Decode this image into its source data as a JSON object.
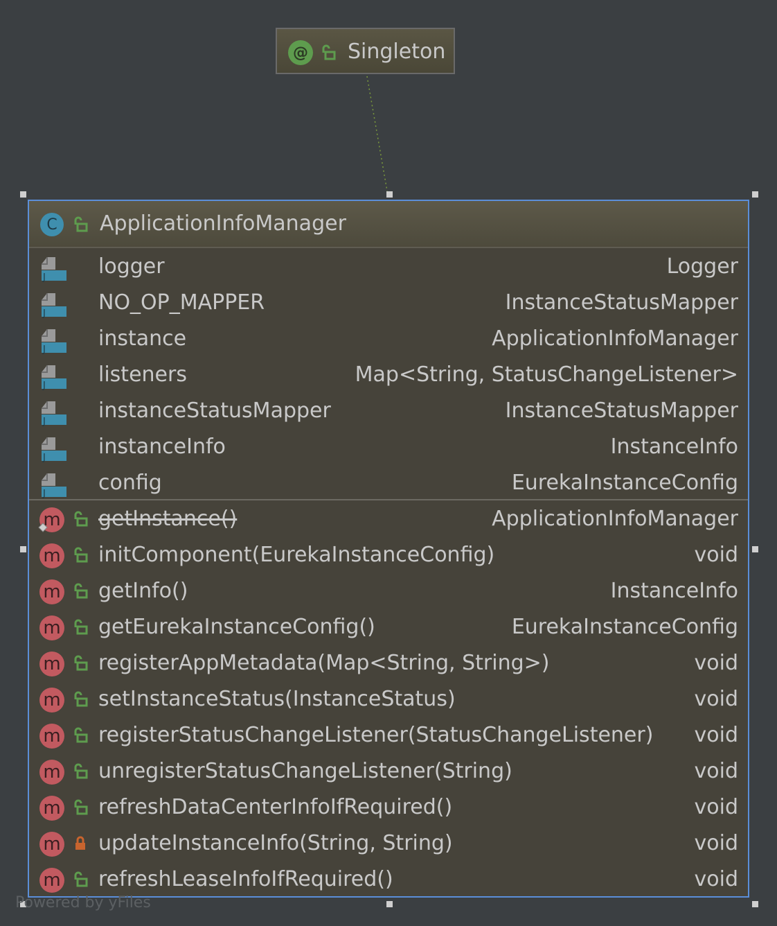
{
  "annotation": {
    "icon_label": "@",
    "name": "Singleton"
  },
  "class": {
    "icon_label": "C",
    "name": "ApplicationInfoManager",
    "fields": [
      {
        "name": "logger",
        "type": "Logger"
      },
      {
        "name": "NO_OP_MAPPER",
        "type": "InstanceStatusMapper"
      },
      {
        "name": "instance",
        "type": "ApplicationInfoManager"
      },
      {
        "name": "listeners",
        "type": "Map<String, StatusChangeListener>"
      },
      {
        "name": "instanceStatusMapper",
        "type": "InstanceStatusMapper"
      },
      {
        "name": "instanceInfo",
        "type": "InstanceInfo"
      },
      {
        "name": "config",
        "type": "EurekaInstanceConfig"
      }
    ],
    "methods": [
      {
        "icon_label": "m",
        "name": "getInstance()",
        "type": "ApplicationInfoManager",
        "access": "public",
        "deprecated": true
      },
      {
        "icon_label": "m",
        "name": "initComponent(EurekaInstanceConfig)",
        "type": "void",
        "access": "public"
      },
      {
        "icon_label": "m",
        "name": "getInfo()",
        "type": "InstanceInfo",
        "access": "public"
      },
      {
        "icon_label": "m",
        "name": "getEurekaInstanceConfig()",
        "type": "EurekaInstanceConfig",
        "access": "public"
      },
      {
        "icon_label": "m",
        "name": "registerAppMetadata(Map<String, String>)",
        "type": "void",
        "access": "public"
      },
      {
        "icon_label": "m",
        "name": "setInstanceStatus(InstanceStatus)",
        "type": "void",
        "access": "public"
      },
      {
        "icon_label": "m",
        "name": "registerStatusChangeListener(StatusChangeListener)",
        "type": "void",
        "access": "public"
      },
      {
        "icon_label": "m",
        "name": "unregisterStatusChangeListener(String)",
        "type": "void",
        "access": "public"
      },
      {
        "icon_label": "m",
        "name": "refreshDataCenterInfoIfRequired()",
        "type": "void",
        "access": "public"
      },
      {
        "icon_label": "m",
        "name": "updateInstanceInfo(String, String)",
        "type": "void",
        "access": "private"
      },
      {
        "icon_label": "m",
        "name": "refreshLeaseInfoIfRequired()",
        "type": "void",
        "access": "public"
      }
    ]
  },
  "watermark": "Powered by yFiles",
  "colors": {
    "background": "#3b3f42",
    "selection_border": "#5b8ed8",
    "public_lock": "#5e9c4e",
    "private_lock": "#c8642e",
    "method_icon": "#c25a60",
    "class_icon": "#3f8fae"
  }
}
